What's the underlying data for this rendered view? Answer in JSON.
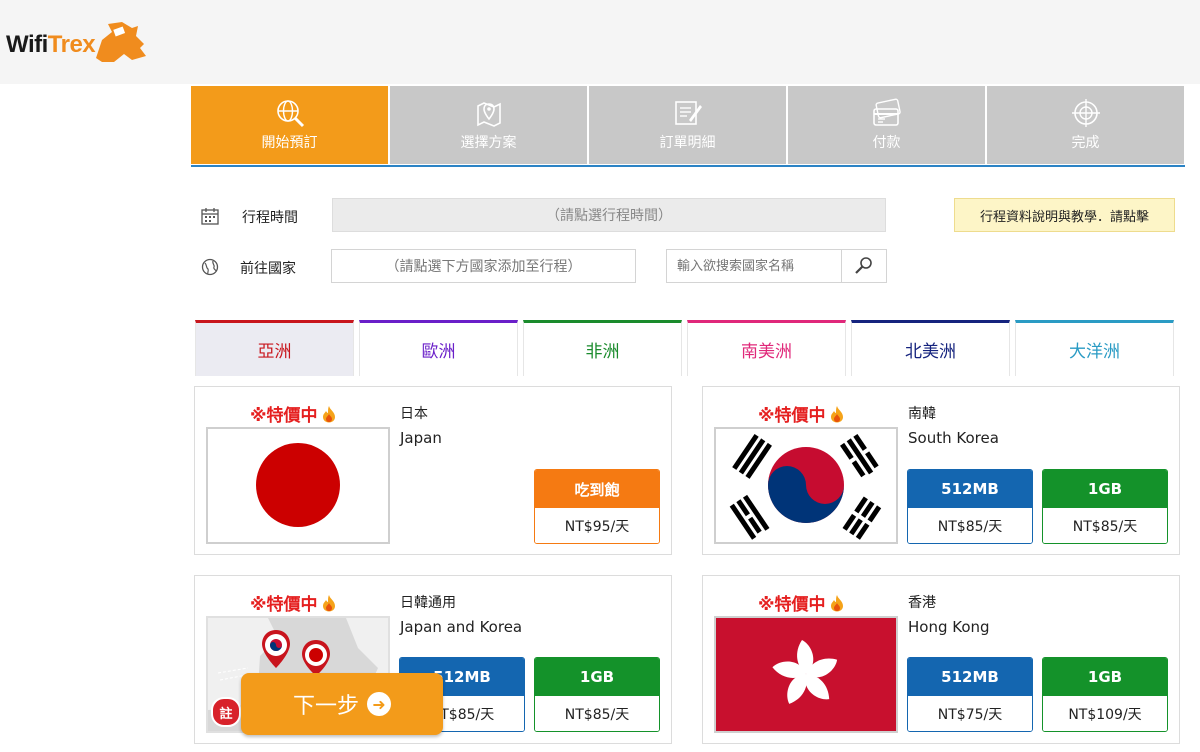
{
  "brand": {
    "logo_text_a": "Wifi",
    "logo_text_b": "Trex"
  },
  "steps": [
    {
      "label": "開始預訂",
      "icon": "globe-search-icon",
      "active": true
    },
    {
      "label": "選擇方案",
      "icon": "map-pin-icon",
      "active": false
    },
    {
      "label": "訂單明細",
      "icon": "edit-document-icon",
      "active": false
    },
    {
      "label": "付款",
      "icon": "credit-card-icon",
      "active": false
    },
    {
      "label": "完成",
      "icon": "target-icon",
      "active": false
    }
  ],
  "form": {
    "date_label": "行程時間",
    "date_placeholder": "（請點選行程時間）",
    "help_button": "行程資料說明與教學．請點擊",
    "country_label": "前往國家",
    "country_placeholder": "（請點選下方國家添加至行程）",
    "search_placeholder": "輸入欲搜索國家名稱"
  },
  "regions": [
    {
      "label": "亞洲",
      "color": "#c8161d",
      "active": true
    },
    {
      "label": "歐洲",
      "color": "#6a1fc9",
      "active": false
    },
    {
      "label": "非洲",
      "color": "#1a8b2c",
      "active": false
    },
    {
      "label": "南美洲",
      "color": "#e0287a",
      "active": false
    },
    {
      "label": "北美洲",
      "color": "#15237e",
      "active": false
    },
    {
      "label": "大洋洲",
      "color": "#2a9bc4",
      "active": false
    }
  ],
  "products": [
    {
      "promo": "※特價中",
      "name_zh": "日本",
      "name_en": "Japan",
      "flag": "japan-flag",
      "plans": [
        {
          "label": "吃到飽",
          "price": "NT$95/天",
          "color": "#f57a12"
        }
      ]
    },
    {
      "promo": "※特價中",
      "name_zh": "南韓",
      "name_en": "South Korea",
      "flag": "korea-flag",
      "plans": [
        {
          "label": "512MB",
          "price": "NT$85/天",
          "color": "#1466b0"
        },
        {
          "label": "1GB",
          "price": "NT$85/天",
          "color": "#14922a"
        }
      ]
    },
    {
      "promo": "※特價中",
      "name_zh": "日韓通用",
      "name_en": "Japan and Korea",
      "flag": "japan-korea-map",
      "plans": [
        {
          "label": "512MB",
          "price": "NT$85/天",
          "color": "#1466b0"
        },
        {
          "label": "1GB",
          "price": "NT$85/天",
          "color": "#14922a"
        }
      ]
    },
    {
      "promo": "※特價中",
      "name_zh": "香港",
      "name_en": "Hong Kong",
      "flag": "hongkong-flag",
      "plans": [
        {
          "label": "512MB",
          "price": "NT$75/天",
          "color": "#1466b0"
        },
        {
          "label": "1GB",
          "price": "NT$109/天",
          "color": "#14922a"
        }
      ]
    }
  ],
  "next_button": {
    "label": "下一步",
    "icon": "arrow-circle-right-icon"
  },
  "note_badge": "註"
}
